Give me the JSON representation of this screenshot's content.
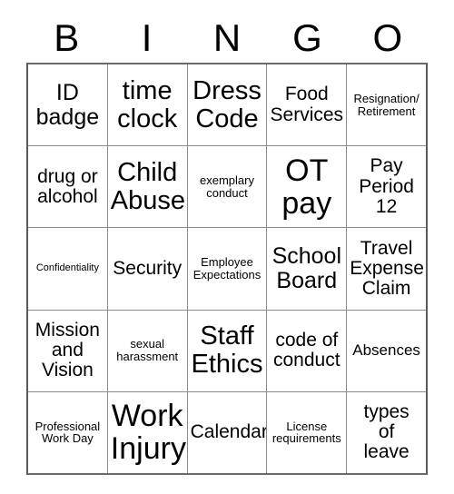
{
  "card": {
    "header_letters": [
      "B",
      "I",
      "N",
      "G",
      "O"
    ],
    "rows": [
      [
        {
          "text": "ID\nbadge",
          "size": "lg"
        },
        {
          "text": "time\nclock",
          "size": "xl"
        },
        {
          "text": "Dress\nCode",
          "size": "xl"
        },
        {
          "text": "Food\nServices",
          "size": "md"
        },
        {
          "text": "Resignation/\nRetirement",
          "size": "xs"
        }
      ],
      [
        {
          "text": "drug or\nalcohol",
          "size": "md"
        },
        {
          "text": "Child\nAbuse",
          "size": "xl"
        },
        {
          "text": "exemplary\nconduct",
          "size": "xs"
        },
        {
          "text": "OT\npay",
          "size": "xxl"
        },
        {
          "text": "Pay\nPeriod\n12",
          "size": "md"
        }
      ],
      [
        {
          "text": "Confidentiality",
          "size": "xxs"
        },
        {
          "text": "Security",
          "size": "md"
        },
        {
          "text": "Employee\nExpectations",
          "size": "xs"
        },
        {
          "text": "School\nBoard",
          "size": "lg"
        },
        {
          "text": "Travel\nExpense\nClaim",
          "size": "md"
        }
      ],
      [
        {
          "text": "Mission\nand\nVision",
          "size": "md"
        },
        {
          "text": "sexual\nharassment",
          "size": "xs"
        },
        {
          "text": "Staff\nEthics",
          "size": "xl"
        },
        {
          "text": "code of\nconduct",
          "size": "md"
        },
        {
          "text": "Absences",
          "size": "sm"
        }
      ],
      [
        {
          "text": "Professional\nWork Day",
          "size": "xs"
        },
        {
          "text": "Work\nInjury",
          "size": "xxl"
        },
        {
          "text": "Calendar",
          "size": "md"
        },
        {
          "text": "License\nrequirements",
          "size": "xs"
        },
        {
          "text": "types\nof\nleave",
          "size": "md"
        }
      ]
    ]
  }
}
